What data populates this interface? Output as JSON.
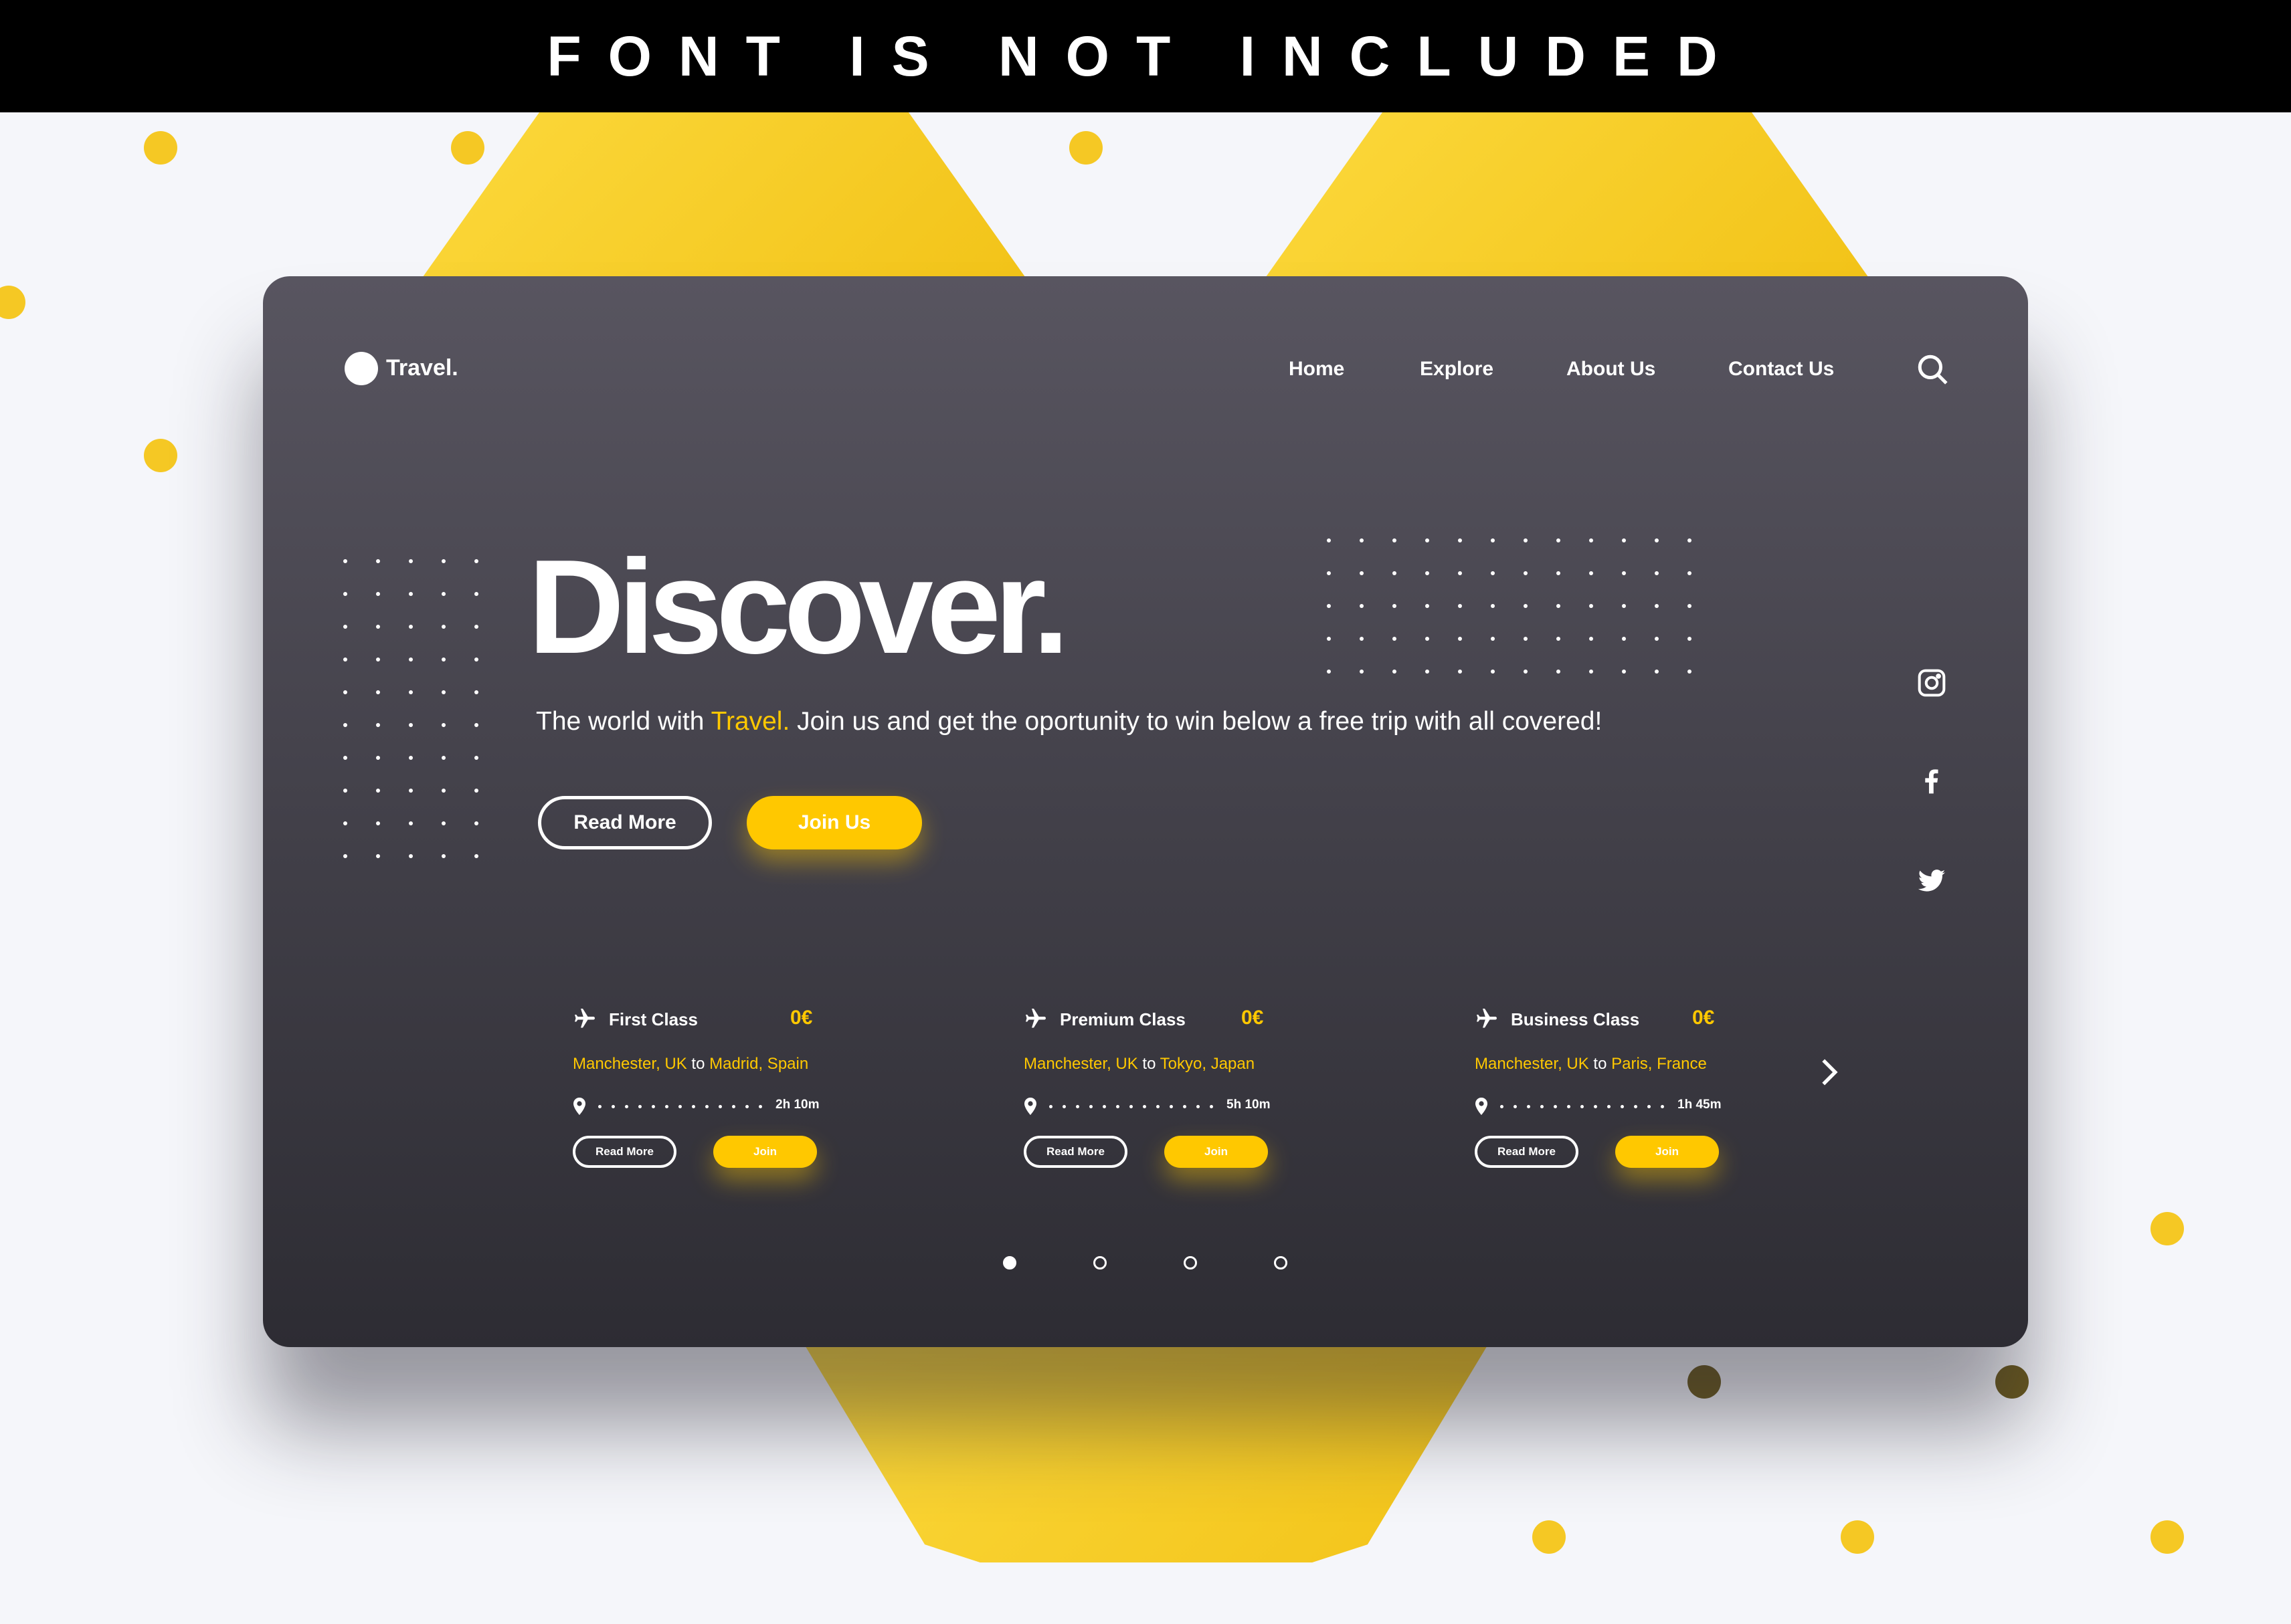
{
  "banner": "FONT IS NOT INCLUDED",
  "logo": "Travel.",
  "nav": [
    "Home",
    "Explore",
    "About Us",
    "Contact Us"
  ],
  "hero": {
    "title": "Discover.",
    "sub_pre": "The world with ",
    "sub_brand": "Travel.",
    "sub_post": " Join us and get the oportunity to win below a free trip with all covered!",
    "read_more": "Read More",
    "join": "Join Us"
  },
  "cards": [
    {
      "title": "First Class",
      "price": "0€",
      "from": "Manchester, UK",
      "to_word": "to",
      "to": "Madrid, Spain",
      "duration": "2h 10m",
      "read_more": "Read More",
      "join": "Join"
    },
    {
      "title": "Premium Class",
      "price": "0€",
      "from": "Manchester, UK",
      "to_word": "to",
      "to": "Tokyo, Japan",
      "duration": "5h 10m",
      "read_more": "Read More",
      "join": "Join"
    },
    {
      "title": "Business Class",
      "price": "0€",
      "from": "Manchester, UK",
      "to_word": "to",
      "to": "Paris, France",
      "duration": "1h 45m",
      "read_more": "Read More",
      "join": "Join"
    }
  ],
  "pagination": {
    "count": 4,
    "active": 1
  },
  "colors": {
    "accent": "#ffc800",
    "card_top": "#585560",
    "card_bottom": "#2d2c33"
  }
}
